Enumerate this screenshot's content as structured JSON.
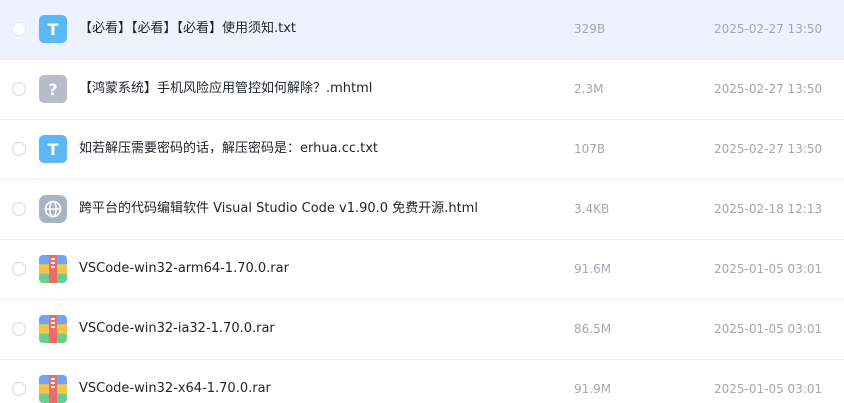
{
  "files": [
    {
      "name": "【必看】【必看】【必看】使用须知.txt",
      "size": "329B",
      "date": "2025-02-27 13:50",
      "icon": "txt-file-icon"
    },
    {
      "name": "【鸿蒙系统】手机风险应用管控如何解除？.mhtml",
      "size": "2.3M",
      "date": "2025-02-27 13:50",
      "icon": "unknown-file-icon"
    },
    {
      "name": "如若解压需要密码的话，解压密码是：erhua.cc.txt",
      "size": "107B",
      "date": "2025-02-27 13:50",
      "icon": "txt-file-icon"
    },
    {
      "name": "跨平台的代码编辑软件 Visual Studio Code v1.90.0 免费开源.html",
      "size": "3.4KB",
      "date": "2025-02-18 12:13",
      "icon": "html-file-icon"
    },
    {
      "name": "VSCode-win32-arm64-1.70.0.rar",
      "size": "91.6M",
      "date": "2025-01-05 03:01",
      "icon": "rar-archive-icon"
    },
    {
      "name": "VSCode-win32-ia32-1.70.0.rar",
      "size": "86.5M",
      "date": "2025-01-05 03:01",
      "icon": "rar-archive-icon"
    },
    {
      "name": "VSCode-win32-x64-1.70.0.rar",
      "size": "91.9M",
      "date": "2025-01-05 03:01",
      "icon": "rar-archive-icon"
    }
  ],
  "icon_glyphs": {
    "txt": "T",
    "unknown": "?"
  },
  "colors": {
    "row_hover": "#edf2fe",
    "txt_icon": "#5bb8f2",
    "unknown_icon": "#b7bcc8",
    "html_icon": "#aab3c3",
    "name_text": "#1f2329",
    "meta_text": "#a3a8b0"
  }
}
